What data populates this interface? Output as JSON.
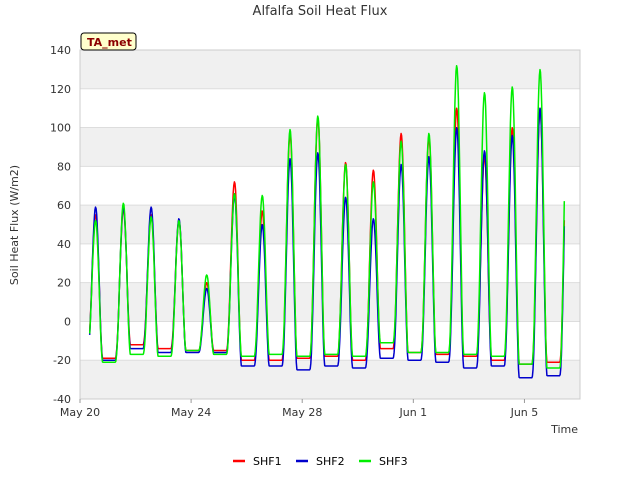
{
  "chart_data": {
    "type": "line",
    "title": "Alfalfa Soil Heat Flux",
    "xlabel": "Time",
    "ylabel": "Soil Heat Flux (W/m2)",
    "badge": "TA_met",
    "ylim": [
      -40,
      140
    ],
    "xlim_days": [
      0,
      18
    ],
    "y_ticks": [
      -40,
      -20,
      0,
      20,
      40,
      60,
      80,
      100,
      120,
      140
    ],
    "x_ticks": [
      {
        "label": "May 20",
        "day": 0
      },
      {
        "label": "May 24",
        "day": 4
      },
      {
        "label": "May 28",
        "day": 8
      },
      {
        "label": "Jun 1",
        "day": 12
      },
      {
        "label": "Jun 5",
        "day": 16
      }
    ],
    "grid": true,
    "legend_position": "bottom-center",
    "series": [
      {
        "name": "SHF1",
        "color": "#ff0000",
        "start_day": 0.35,
        "peak_hour": 13.5,
        "daily_max": [
          55,
          58,
          55,
          52,
          20,
          72,
          57,
          97,
          105,
          82,
          78,
          97,
          95,
          110,
          85,
          100,
          110
        ],
        "daily_min": [
          -15,
          -19,
          -12,
          -14,
          -15,
          -15,
          -20,
          -20,
          -19,
          -18,
          -20,
          -14,
          -16,
          -17,
          -18,
          -20,
          -22,
          -21
        ]
      },
      {
        "name": "SHF2",
        "color": "#0000cc",
        "start_day": 0.35,
        "peak_hour": 13.5,
        "daily_max": [
          59,
          59,
          59,
          53,
          17,
          65,
          50,
          84,
          87,
          64,
          53,
          81,
          85,
          100,
          88,
          96,
          110
        ],
        "daily_min": [
          -18,
          -20,
          -14,
          -16,
          -16,
          -16,
          -23,
          -23,
          -25,
          -23,
          -24,
          -19,
          -20,
          -21,
          -24,
          -23,
          -29,
          -28
        ]
      },
      {
        "name": "SHF3",
        "color": "#00ee00",
        "start_day": 0.35,
        "peak_hour": 13.5,
        "daily_max": [
          52,
          61,
          54,
          52,
          24,
          66,
          65,
          99,
          106,
          81,
          72,
          93,
          97,
          132,
          118,
          121,
          130
        ],
        "daily_min": [
          -16,
          -21,
          -17,
          -18,
          -15,
          -17,
          -18,
          -17,
          -18,
          -17,
          -18,
          -11,
          -16,
          -16,
          -17,
          -18,
          -22,
          -24
        ]
      }
    ]
  }
}
